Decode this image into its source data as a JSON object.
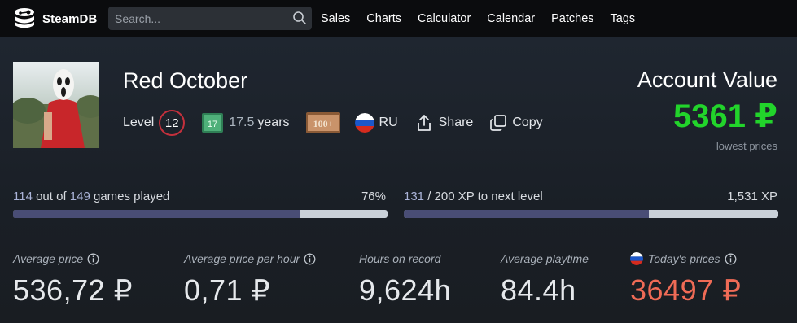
{
  "header": {
    "logo_text": "SteamDB",
    "search_placeholder": "Search...",
    "nav": [
      "Sales",
      "Charts",
      "Calculator",
      "Calendar",
      "Patches",
      "Tags"
    ]
  },
  "profile": {
    "name": "Red October",
    "level_label": "Level",
    "level": "12",
    "years_badge": "17",
    "years_value": "17.5",
    "years_unit": "years",
    "badge_100": "100+",
    "country": "RU",
    "share_label": "Share",
    "copy_label": "Copy"
  },
  "account": {
    "title": "Account Value",
    "value": "5361 ₽",
    "subtitle": "lowest prices"
  },
  "progress": {
    "games": {
      "played": "114",
      "mid": " out of ",
      "total": "149",
      "suffix": " games played",
      "percent_label": "76%",
      "fraction": 0.765
    },
    "xp": {
      "current": "131",
      "suffix": " / 200 XP to next level",
      "total_label": "1,531 XP",
      "fraction": 0.655
    }
  },
  "stats": [
    {
      "label": "Average price",
      "value": "536,72 ₽"
    },
    {
      "label": "Average price per hour",
      "value": "0,71 ₽"
    },
    {
      "label": "Hours on record",
      "value": "9,624h"
    },
    {
      "label": "Average playtime",
      "value": "84.4h"
    },
    {
      "label": "Today's prices",
      "value": "36497 ₽"
    }
  ],
  "colors": {
    "accent_value": "#22d42b",
    "todays_price": "#ef6b56",
    "level_ring": "#c3303c",
    "bar_fill": "#494d75"
  }
}
